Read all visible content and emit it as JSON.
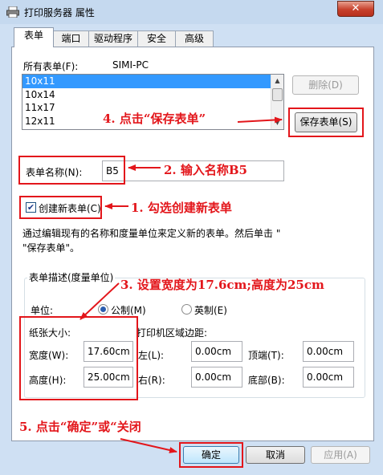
{
  "window": {
    "title": "打印服务器 属性",
    "close": "✕"
  },
  "tabs": [
    "表单",
    "端口",
    "驱动程序",
    "安全",
    "高级"
  ],
  "forms_on": {
    "label": "所有表单(F):",
    "server": "SIMI-PC"
  },
  "form_list": {
    "items": [
      "10x11",
      "10x14",
      "11x17",
      "12x11"
    ],
    "selected": "10x11"
  },
  "buttons": {
    "delete": "删除(D)",
    "save_form": "保存表单(S)",
    "ok": "确定",
    "cancel": "取消",
    "apply": "应用(A)"
  },
  "form_name": {
    "label": "表单名称(N):",
    "value": "B5"
  },
  "create_new": {
    "label": "创建新表单(C)",
    "checked": true
  },
  "description": "通过编辑现有的名称和度量单位来定义新的表单。然后单击 \"\n\"保存表单\"。",
  "group": {
    "caption": "表单描述(度量单位)",
    "unit_label": "单位:",
    "metric": "公制(M)",
    "english": "英制(E)",
    "unit_selected": "metric",
    "paper_size": "纸张大小:",
    "printer_margins": "打印机区域边距:"
  },
  "fields": {
    "width_label": "宽度(W):",
    "width_value": "17.60cm",
    "height_label": "高度(H):",
    "height_value": "25.00cm",
    "left_label": "左(L):",
    "left_value": "0.00cm",
    "right_label": "右(R):",
    "right_value": "0.00cm",
    "top_label": "顶端(T):",
    "top_value": "0.00cm",
    "bottom_label": "底部(B):",
    "bottom_value": "0.00cm"
  },
  "annotations": {
    "step1": "1. 勾选创建新表单",
    "step2": "2. 输入名称B5",
    "step3": "3. 设置宽度为17.6cm;高度为25cm",
    "step4": "4. 点击“保存表单”",
    "step5": "5. 点击“确定”或“关闭"
  },
  "colors": {
    "annotation": "#e3161b",
    "selection": "#3399ff",
    "window_frame": "#cfe0f3"
  }
}
